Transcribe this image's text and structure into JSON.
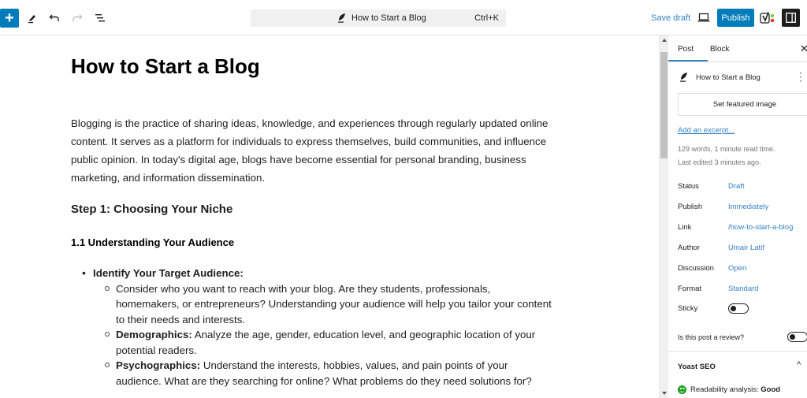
{
  "toolbar": {
    "inserter_icon": "plus-icon",
    "tools_icon": "pencil-icon",
    "undo_icon": "undo-icon",
    "redo_icon": "redo-icon",
    "document_overview_icon": "list-view-icon",
    "command_bar": {
      "icon": "feather-icon",
      "title": "How to Start a Blog",
      "shortcut": "Ctrl+K"
    },
    "save_draft_label": "Save draft",
    "preview_icon": "laptop-icon",
    "publish_label": "Publish",
    "yoast_icon": "yoast-icon",
    "settings_icon": "sidebar-toggle-icon"
  },
  "editor": {
    "title": "How to Start a Blog",
    "intro": "Blogging is the practice of sharing ideas, knowledge, and experiences through regularly updated online content. It serves as a platform for individuals to express themselves, build communities, and influence public opinion. In today's digital age, blogs have become essential for personal branding, business marketing, and information dissemination.",
    "h2": "Step 1: Choosing Your Niche",
    "h3": "1.1 Understanding Your Audience",
    "list": {
      "item1": "Identify Your Target Audience:",
      "sub": [
        {
          "label": "",
          "text": "Consider who you want to reach with your blog. Are they students, professionals, homemakers, or entrepreneurs? Understanding your audience will help you tailor your content to their needs and interests."
        },
        {
          "label": "Demographics:",
          "text": " Analyze the age, gender, education level, and geographic location of your potential readers."
        },
        {
          "label": "Psychographics:",
          "text": " Understand the interests, hobbies, values, and pain points of your audience. What are they searching for online? What problems do they need solutions for?"
        }
      ]
    }
  },
  "sidebar": {
    "tabs": [
      {
        "label": "Post",
        "active": true
      },
      {
        "label": "Block",
        "active": false
      }
    ],
    "close_icon": "close-icon",
    "post_title": "How to Start a Blog",
    "featured_image_label": "Set featured image",
    "excerpt_link": "Add an excerpt...",
    "word_info": "129 words, 1 minute read time.",
    "last_edited": "Last edited 3 minutes ago.",
    "rows": [
      {
        "key": "Status",
        "value": "Draft"
      },
      {
        "key": "Publish",
        "value": "Immediately"
      },
      {
        "key": "Link",
        "value": "/how-to-start-a-blog"
      },
      {
        "key": "Author",
        "value": "Umair Latif"
      },
      {
        "key": "Discussion",
        "value": "Open"
      },
      {
        "key": "Format",
        "value": "Standard"
      }
    ],
    "sticky_label": "Sticky",
    "sticky_on": false,
    "review_label": "Is this post a review?",
    "review_on": false,
    "yoast": {
      "heading": "Yoast SEO",
      "readability_label": "Readability analysis:",
      "readability_value": "Good"
    }
  },
  "colors": {
    "accent": "#007cba",
    "link": "#3582c4",
    "good": "#1ea11e"
  }
}
